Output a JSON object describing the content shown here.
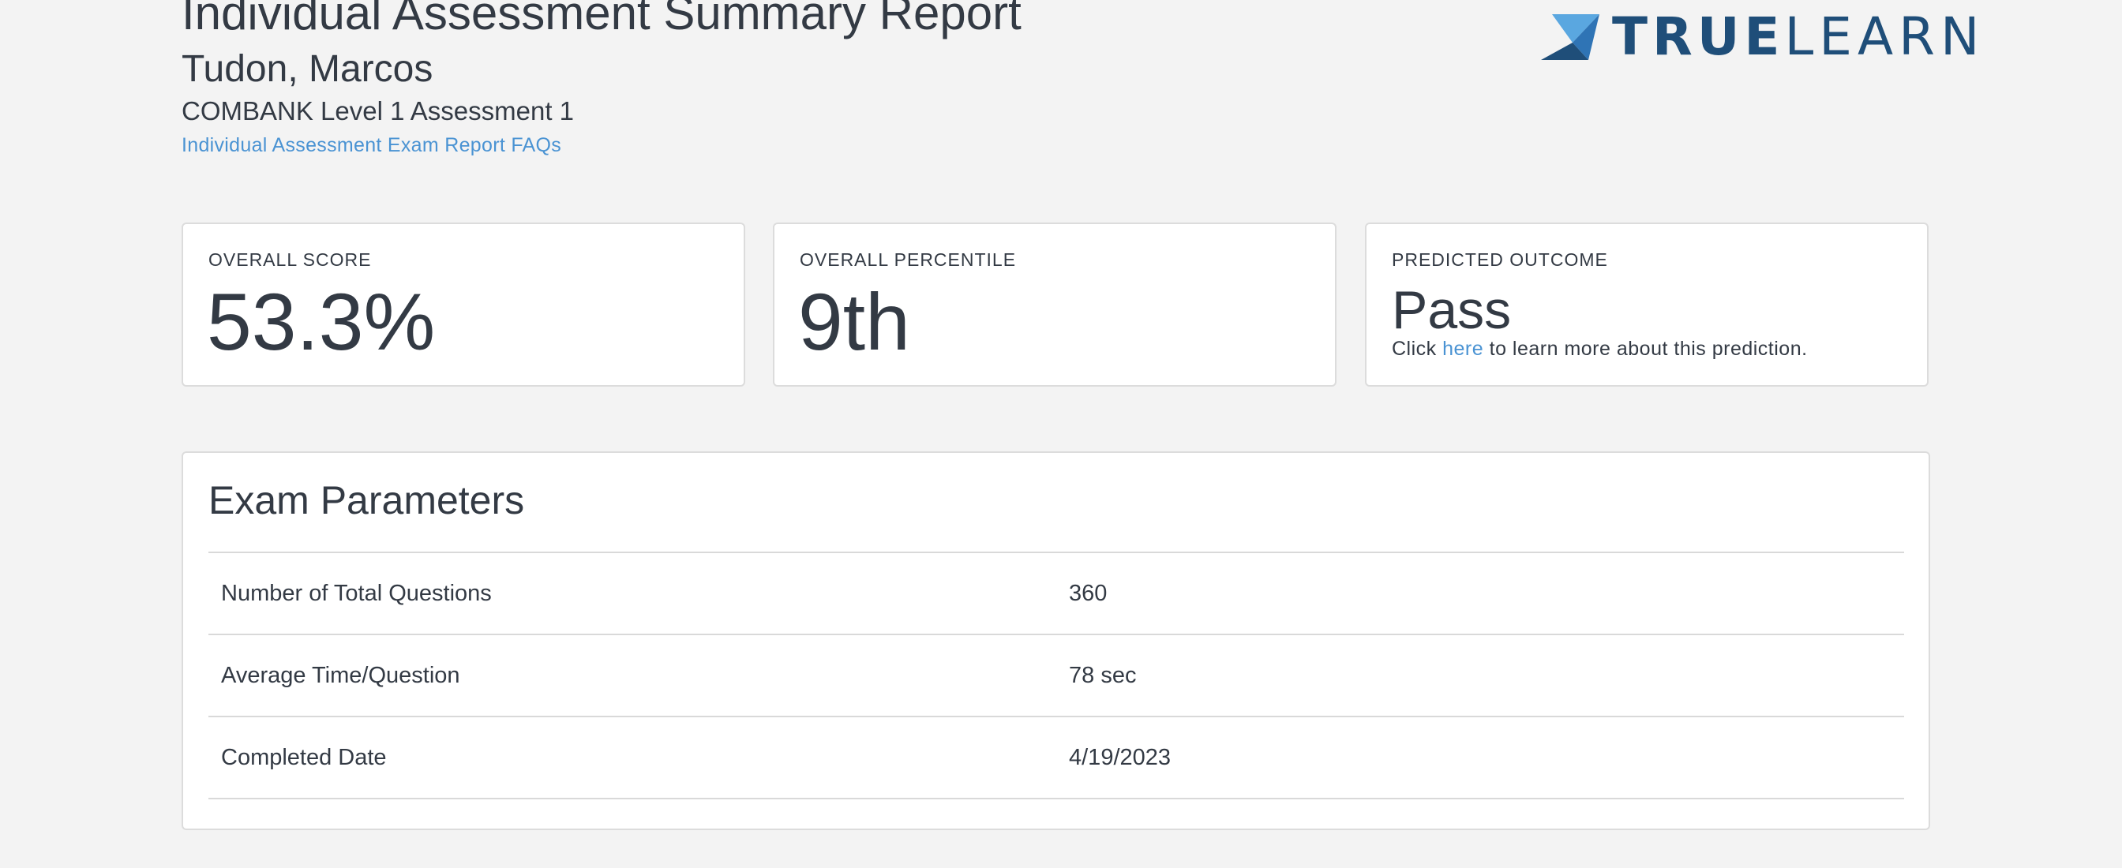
{
  "header": {
    "report_title": "Individual Assessment Summary Report",
    "student_name": "Tudon, Marcos",
    "assessment_name": "COMBANK Level 1 Assessment 1",
    "faq_link": "Individual Assessment Exam Report FAQs"
  },
  "logo": {
    "text_bold": "TRUE",
    "text_light": "LEARN",
    "colors": {
      "mark_light": "#5aa7e0",
      "mark_dark": "#1f4e79",
      "text": "#1f4e79"
    }
  },
  "cards": {
    "overall_score": {
      "label": "OVERALL SCORE",
      "value": "53.3%"
    },
    "overall_percentile": {
      "label": "OVERALL PERCENTILE",
      "value": "9th"
    },
    "predicted_outcome": {
      "label": "PREDICTED OUTCOME",
      "value": "Pass",
      "note_prefix": "Click",
      "note_link": "here",
      "note_suffix": "to learn more about this prediction."
    }
  },
  "exam_parameters": {
    "title": "Exam Parameters",
    "rows": [
      {
        "label": "Number of Total Questions",
        "value": "360"
      },
      {
        "label": "Average Time/Question",
        "value": "78 sec"
      },
      {
        "label": "Completed Date",
        "value": "4/19/2023"
      }
    ]
  },
  "colors": {
    "background": "#f3f3f3",
    "text": "#333a44",
    "link": "#4a93d3",
    "card_border": "#dcdcdc"
  }
}
